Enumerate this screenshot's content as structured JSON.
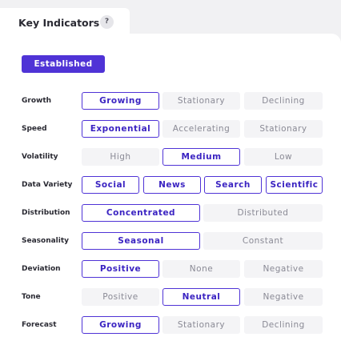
{
  "header": {
    "title": "Key Indicators",
    "help_icon": "?"
  },
  "status_badge": "Established",
  "rows": [
    {
      "label": "Growth",
      "options": [
        {
          "text": "Growing",
          "selected": true
        },
        {
          "text": "Stationary",
          "selected": false
        },
        {
          "text": "Declining",
          "selected": false
        }
      ]
    },
    {
      "label": "Speed",
      "options": [
        {
          "text": "Exponential",
          "selected": true
        },
        {
          "text": "Accelerating",
          "selected": false
        },
        {
          "text": "Stationary",
          "selected": false
        }
      ]
    },
    {
      "label": "Volatility",
      "options": [
        {
          "text": "High",
          "selected": false
        },
        {
          "text": "Medium",
          "selected": true
        },
        {
          "text": "Low",
          "selected": false
        }
      ]
    },
    {
      "label": "Data Variety",
      "options": [
        {
          "text": "Social",
          "selected": true
        },
        {
          "text": "News",
          "selected": true
        },
        {
          "text": "Search",
          "selected": true
        },
        {
          "text": "Scientific",
          "selected": true
        }
      ]
    },
    {
      "label": "Distribution",
      "options": [
        {
          "text": "Concentrated",
          "selected": true
        },
        {
          "text": "Distributed",
          "selected": false
        }
      ]
    },
    {
      "label": "Seasonality",
      "options": [
        {
          "text": "Seasonal",
          "selected": true
        },
        {
          "text": "Constant",
          "selected": false
        }
      ]
    },
    {
      "label": "Deviation",
      "options": [
        {
          "text": "Positive",
          "selected": true
        },
        {
          "text": "None",
          "selected": false
        },
        {
          "text": "Negative",
          "selected": false
        }
      ]
    },
    {
      "label": "Tone",
      "options": [
        {
          "text": "Positive",
          "selected": false
        },
        {
          "text": "Neutral",
          "selected": true
        },
        {
          "text": "Negative",
          "selected": false
        }
      ]
    },
    {
      "label": "Forecast",
      "options": [
        {
          "text": "Growing",
          "selected": true
        },
        {
          "text": "Stationary",
          "selected": false
        },
        {
          "text": "Declining",
          "selected": false
        }
      ]
    }
  ],
  "colors": {
    "accent": "#4f33d6",
    "inactive_bg": "#f4f4f6",
    "page_bg": "#f1f1f3"
  }
}
